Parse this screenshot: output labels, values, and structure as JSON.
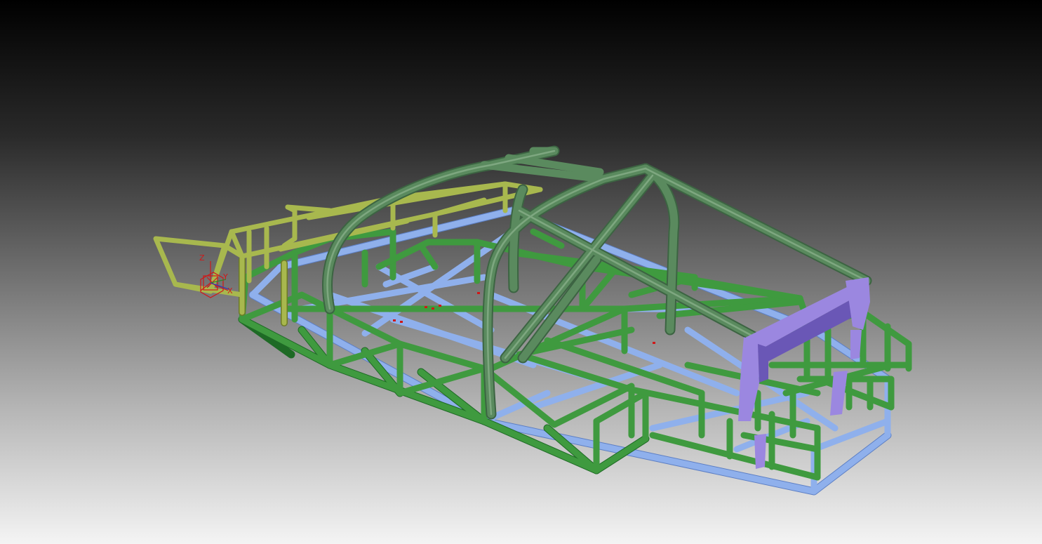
{
  "viewport": {
    "background_top": "#000000",
    "background_bottom": "#f4f4f4"
  },
  "model": {
    "colors": {
      "floor_frame": "#8fb0ec",
      "floor_frame_dark": "#5d7fc4",
      "side_frame": "#3f9a3f",
      "side_frame_dark": "#1e6a25",
      "roll_cage": "#5a8a5e",
      "roll_cage_dark": "#3c6442",
      "front_frame": "#a8b84e",
      "front_frame_dark": "#6c7a26",
      "rear_bracket": "#9b87e0",
      "rear_bracket_dark": "#6a57b6"
    }
  },
  "triad": {
    "color": "#d01818",
    "z_label": "Z",
    "y_label": "Y",
    "x_label": "X"
  }
}
